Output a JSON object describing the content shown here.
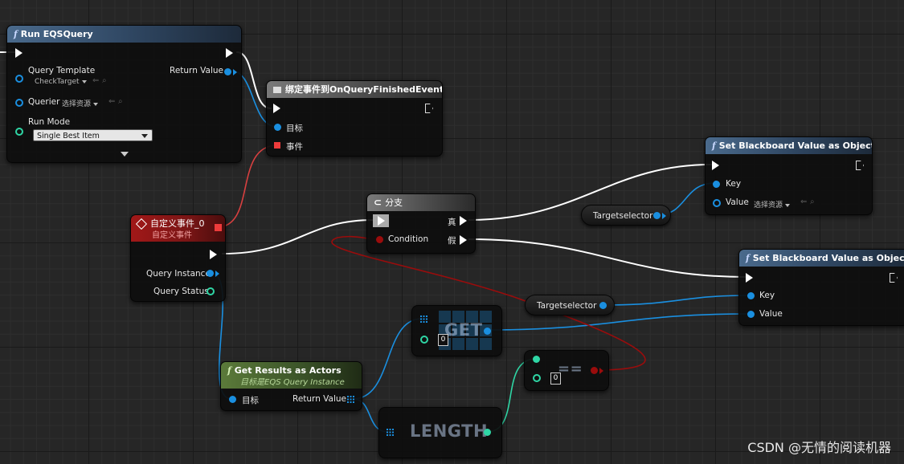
{
  "nodes": {
    "run_eqs": {
      "title": "Run EQSQuery",
      "query_template_label": "Query Template",
      "query_template_value": "CheckTarget",
      "querier_label": "Querier",
      "querier_value": "选择资源",
      "run_mode_label": "Run Mode",
      "run_mode_value": "Single Best Item",
      "return_value_label": "Return Value"
    },
    "bind_event": {
      "title": "绑定事件到OnQueryFinishedEvent",
      "target_label": "目标",
      "event_label": "事件"
    },
    "custom_event": {
      "title": "自定义事件_0",
      "subtitle": "自定义事件",
      "query_instance_label": "Query Instance",
      "query_status_label": "Query Status"
    },
    "branch": {
      "title": "分支",
      "condition_label": "Condition",
      "true_label": "真",
      "false_label": "假"
    },
    "set_bb_1": {
      "title": "Set Blackboard Value as Object",
      "key_label": "Key",
      "value_label": "Value",
      "value_default": "选择资源"
    },
    "set_bb_2": {
      "title": "Set Blackboard Value as Object",
      "key_label": "Key",
      "value_label": "Value"
    },
    "targetselector_1": {
      "label": "Targetselector"
    },
    "targetselector_2": {
      "label": "Targetselector"
    },
    "get": {
      "title": "GET",
      "index": "0"
    },
    "equals": {
      "title": "==",
      "value": "0"
    },
    "length": {
      "title": "LENGTH"
    },
    "get_results": {
      "title": "Get Results as Actors",
      "subtitle": "目标是EQS Query Instance",
      "target_label": "目标",
      "return_value_label": "Return Value"
    }
  },
  "watermark": "CSDN @无情的阅读机器",
  "colors": {
    "background": "#262626",
    "exec_wire": "#ffffff",
    "object_wire": "#1a8fe0",
    "int_wire": "#2fd6a5",
    "bool_wire": "#9a0c0c",
    "delegate_wire": "#e04040"
  },
  "icons": [
    "function-icon",
    "event-diamond-icon",
    "branch-icon",
    "delegate-icon",
    "array-grid-icon"
  ]
}
